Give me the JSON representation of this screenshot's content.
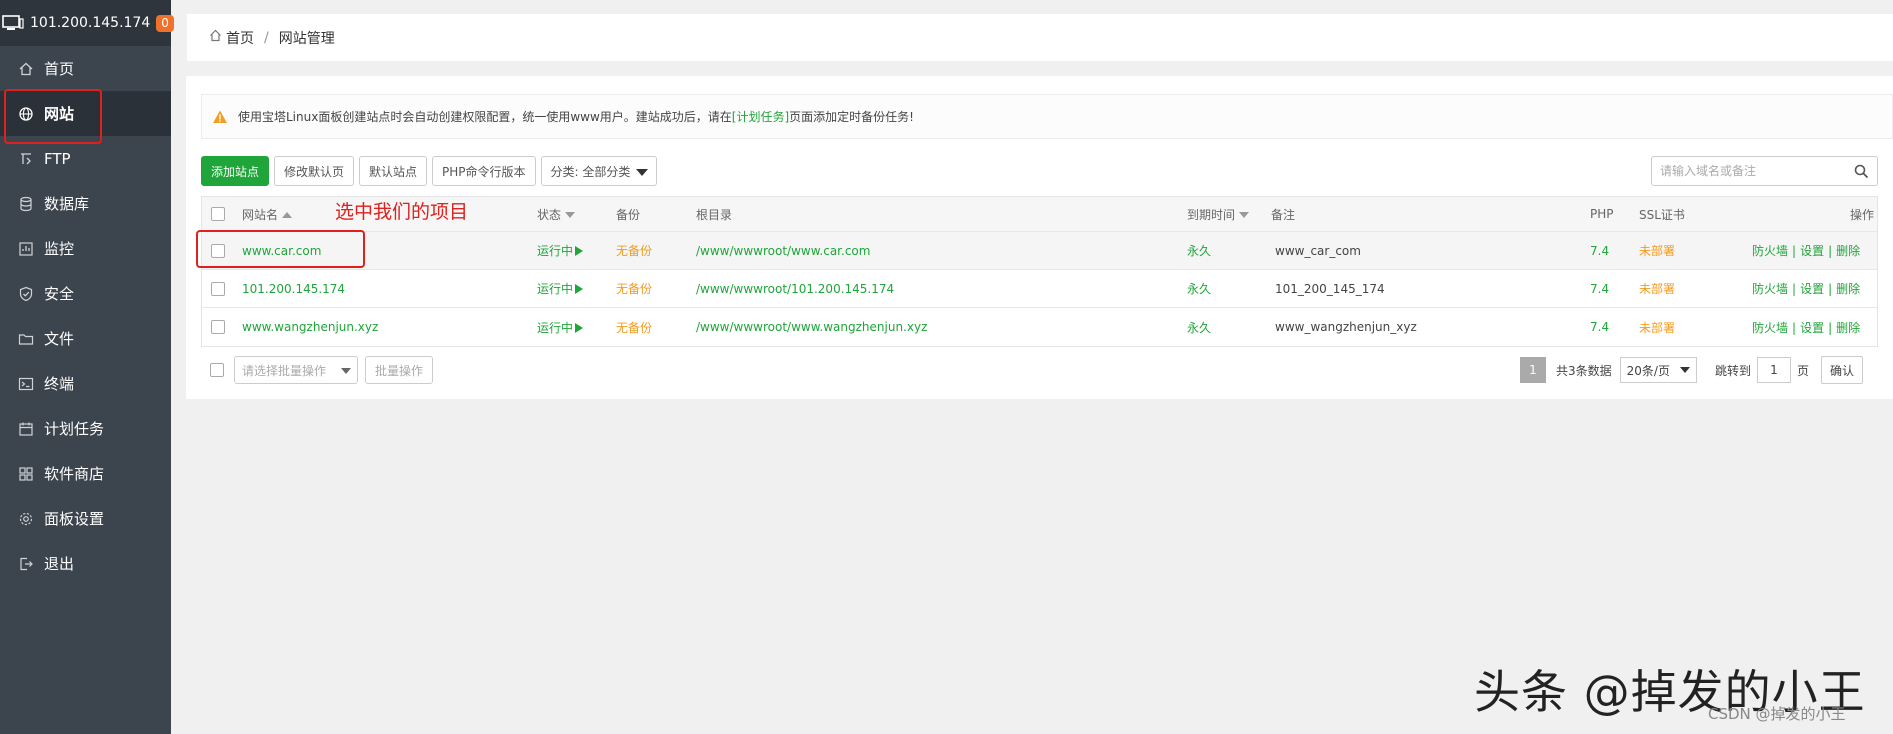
{
  "sidebar": {
    "server_ip": "101.200.145.174",
    "badge": "0",
    "items": [
      {
        "label": "首页",
        "icon": "home-icon"
      },
      {
        "label": "网站",
        "icon": "globe-icon",
        "active": true
      },
      {
        "label": "FTP",
        "icon": "ftp-icon"
      },
      {
        "label": "数据库",
        "icon": "database-icon"
      },
      {
        "label": "监控",
        "icon": "monitor-icon"
      },
      {
        "label": "安全",
        "icon": "shield-icon"
      },
      {
        "label": "文件",
        "icon": "folder-icon"
      },
      {
        "label": "终端",
        "icon": "terminal-icon"
      },
      {
        "label": "计划任务",
        "icon": "calendar-icon"
      },
      {
        "label": "软件商店",
        "icon": "apps-icon"
      },
      {
        "label": "面板设置",
        "icon": "gear-icon"
      },
      {
        "label": "退出",
        "icon": "logout-icon"
      }
    ]
  },
  "breadcrumb": {
    "home": "首页",
    "sep": "/",
    "current": "网站管理"
  },
  "notice": {
    "before": "使用宝塔Linux面板创建站点时会自动创建权限配置，统一使用www用户。建站成功后，请在",
    "link": "[计划任务]",
    "after": "页面添加定时备份任务!"
  },
  "toolbar": {
    "add_site": "添加站点",
    "edit_default_page": "修改默认页",
    "default_site": "默认站点",
    "php_cli": "PHP命令行版本",
    "category": "分类: 全部分类"
  },
  "search": {
    "placeholder": "请输入域名或备注"
  },
  "table": {
    "headers": {
      "name": "网站名",
      "status": "状态",
      "backup": "备份",
      "root": "根目录",
      "expire": "到期时间",
      "remark": "备注",
      "php": "PHP",
      "ssl": "SSL证书",
      "ops": "操作"
    },
    "rows": [
      {
        "name": "www.car.com",
        "status": "运行中",
        "backup": "无备份",
        "root": "/www/wwwroot/www.car.com",
        "expire": "永久",
        "remark": "www_car_com",
        "php": "7.4",
        "ssl": "未部署",
        "op_firewall": "防火墙",
        "op_settings": "设置",
        "op_delete": "删除"
      },
      {
        "name": "101.200.145.174",
        "status": "运行中",
        "backup": "无备份",
        "root": "/www/wwwroot/101.200.145.174",
        "expire": "永久",
        "remark": "101_200_145_174",
        "php": "7.4",
        "ssl": "未部署",
        "op_firewall": "防火墙",
        "op_settings": "设置",
        "op_delete": "删除"
      },
      {
        "name": "www.wangzhenjun.xyz",
        "status": "运行中",
        "backup": "无备份",
        "root": "/www/wwwroot/www.wangzhenjun.xyz",
        "expire": "永久",
        "remark": "www_wangzhenjun_xyz",
        "php": "7.4",
        "ssl": "未部署",
        "op_firewall": "防火墙",
        "op_settings": "设置",
        "op_delete": "删除"
      }
    ]
  },
  "annotation": "选中我们的项目",
  "footer": {
    "batch_placeholder": "请选择批量操作",
    "batch_button": "批量操作",
    "page": "1",
    "total": "共3条数据",
    "per_page": "20条/页",
    "jump_label": "跳转到",
    "jump_value": "1",
    "page_unit": "页",
    "confirm": "确认"
  },
  "watermark": {
    "main": "头条 @掉发的小王",
    "csdn": "CSDN @掉发的小王"
  },
  "colors": {
    "sidebar_bg": "#3c444d",
    "accent_green": "#20a53a",
    "warning_orange": "#f39b1c",
    "highlight_red": "#e0201c",
    "badge_orange": "#f0722a"
  }
}
